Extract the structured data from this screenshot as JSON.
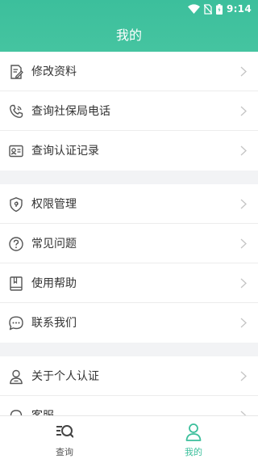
{
  "status_bar": {
    "time": "9:14"
  },
  "header": {
    "title": "我的"
  },
  "menu": {
    "group1": [
      {
        "label": "修改资料",
        "icon": "edit-profile-icon"
      },
      {
        "label": "查询社保局电话",
        "icon": "phone-icon"
      },
      {
        "label": "查询认证记录",
        "icon": "record-card-icon"
      }
    ],
    "group2": [
      {
        "label": "权限管理",
        "icon": "shield-icon"
      },
      {
        "label": "常见问题",
        "icon": "question-icon"
      },
      {
        "label": "使用帮助",
        "icon": "help-book-icon"
      },
      {
        "label": "联系我们",
        "icon": "chat-bubble-icon"
      }
    ],
    "group3": [
      {
        "label": "关于个人认证",
        "icon": "person-icon"
      },
      {
        "label": "客服",
        "icon": "headset-icon"
      }
    ]
  },
  "tabbar": {
    "query_label": "查询",
    "mine_label": "我的",
    "active_tab": "我的"
  },
  "colors": {
    "accent": "#3cbf9c",
    "icon_gray": "#555555",
    "chevron": "#c4c4c4",
    "background": "#f2f3f5"
  }
}
